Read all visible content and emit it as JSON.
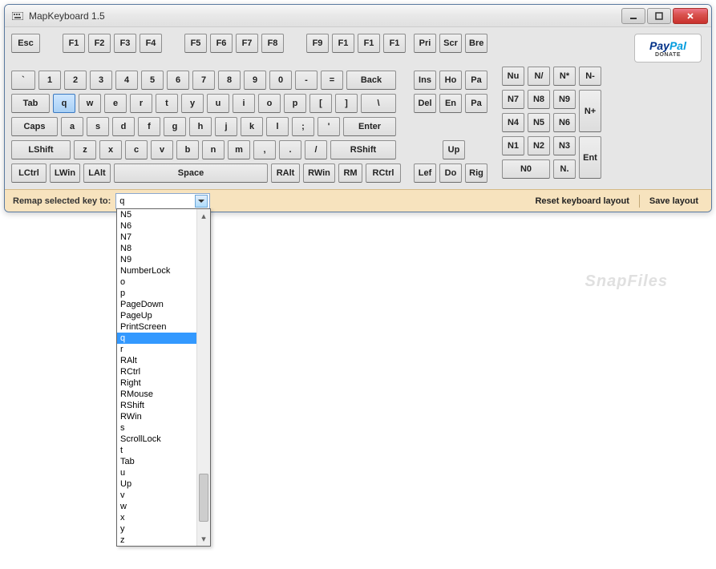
{
  "window": {
    "title": "MapKeyboard 1.5"
  },
  "paypal": {
    "logo1": "Pay",
    "logo2": "Pal",
    "donate": "DONATE"
  },
  "watermark": "SnapFiles",
  "bottombar": {
    "label": "Remap selected key to:",
    "combo_value": "q",
    "reset": "Reset keyboard layout",
    "save": "Save layout"
  },
  "keys": {
    "row0_a": [
      "Esc"
    ],
    "row0_b": [
      "F1",
      "F2",
      "F3",
      "F4"
    ],
    "row0_c": [
      "F5",
      "F6",
      "F7",
      "F8"
    ],
    "row0_d": [
      "F9",
      "F1",
      "F1",
      "F1"
    ],
    "row0_e": [
      "Pri",
      "Scr",
      "Bre"
    ],
    "row1": [
      "`",
      "1",
      "2",
      "3",
      "4",
      "5",
      "6",
      "7",
      "8",
      "9",
      "0",
      "-",
      "="
    ],
    "row1_back": "Back",
    "row2_tab": "Tab",
    "row2": [
      "q",
      "w",
      "e",
      "r",
      "t",
      "y",
      "u",
      "i",
      "o",
      "p",
      "[",
      "]",
      "\\"
    ],
    "row3_caps": "Caps",
    "row3": [
      "a",
      "s",
      "d",
      "f",
      "g",
      "h",
      "j",
      "k",
      "l",
      ";",
      "'"
    ],
    "row3_enter": "Enter",
    "row4_lshift": "LShift",
    "row4": [
      "z",
      "x",
      "c",
      "v",
      "b",
      "n",
      "m",
      ",",
      ".",
      "/"
    ],
    "row4_rshift": "RShift",
    "row5": [
      "LCtrl",
      "LWin",
      "LAlt"
    ],
    "row5_space": "Space",
    "row5_b": [
      "RAlt",
      "RWin",
      "RM",
      "RCtrl"
    ],
    "nav1": [
      "Ins",
      "Ho",
      "Pa"
    ],
    "nav2": [
      "Del",
      "En",
      "Pa"
    ],
    "nav_up": "Up",
    "nav3": [
      "Lef",
      "Do",
      "Rig"
    ],
    "np0": [
      "Nu",
      "N/",
      "N*"
    ],
    "np0_minus": "N-",
    "np1": [
      "N7",
      "N8",
      "N9"
    ],
    "np2": [
      "N4",
      "N5",
      "N6"
    ],
    "np_plus": "N+",
    "np3": [
      "N1",
      "N2",
      "N3"
    ],
    "np4": [
      "N0",
      "N."
    ],
    "np_ent": "Ent"
  },
  "dropdown": {
    "items": [
      "N5",
      "N6",
      "N7",
      "N8",
      "N9",
      "NumberLock",
      "o",
      "p",
      "PageDown",
      "PageUp",
      "PrintScreen",
      "q",
      "r",
      "RAlt",
      "RCtrl",
      "Right",
      "RMouse",
      "RShift",
      "RWin",
      "s",
      "ScrollLock",
      "t",
      "Tab",
      "u",
      "Up",
      "v",
      "w",
      "x",
      "y",
      "z"
    ],
    "selected": "q"
  }
}
